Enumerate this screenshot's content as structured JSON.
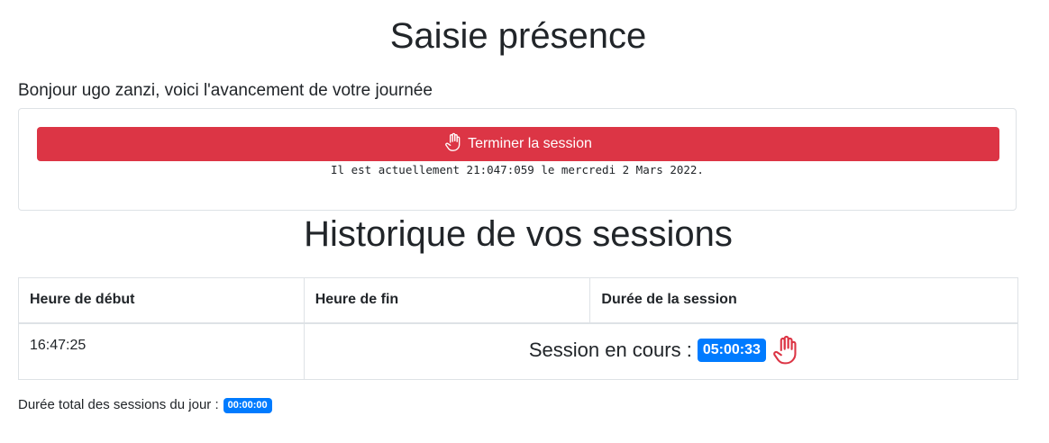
{
  "page": {
    "title": "Saisie présence",
    "greeting": "Bonjour ugo zanzi, voici l'avancement de votre journée"
  },
  "session_card": {
    "end_button_label": "Terminer la session",
    "end_button_icon": "hand-stop-icon",
    "clock_text": "Il est actuellement 21:047:059 le mercredi 2 Mars 2022.",
    "button_color": "#dc3545"
  },
  "history": {
    "title": "Historique de vos sessions",
    "columns": [
      "Heure de début",
      "Heure de fin",
      "Durée de la session"
    ],
    "rows": [
      {
        "start": "16:47:25",
        "status_label": "Session en cours :",
        "duration_badge": "05:00:33",
        "icon": "hand-stop-icon"
      }
    ]
  },
  "total": {
    "label": "Durée total des sessions du jour :",
    "value": "00:00:00"
  },
  "colors": {
    "badge": "#007bff",
    "danger": "#dc3545",
    "border": "#dee2e6"
  }
}
